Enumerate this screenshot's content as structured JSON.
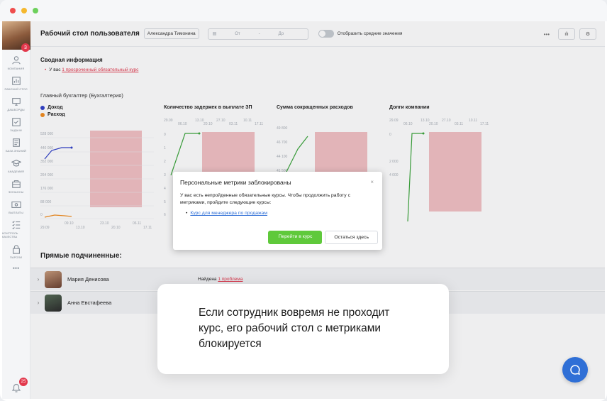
{
  "window": {
    "dots": [
      "#ef4d4d",
      "#f5b82e",
      "#6dd05c"
    ]
  },
  "sidebar": {
    "avatar_badge": "3",
    "items": [
      {
        "label": "Компания",
        "icon": "building-icon"
      },
      {
        "label": "Рабочий стол",
        "icon": "dashboard-icon"
      },
      {
        "label": "Дашборды",
        "icon": "monitor-icon"
      },
      {
        "label": "Задачи",
        "icon": "check-square-icon"
      },
      {
        "label": "База знаний",
        "icon": "document-icon"
      },
      {
        "label": "Академия",
        "icon": "graduation-cap-icon"
      },
      {
        "label": "Финансы",
        "icon": "finance-icon"
      },
      {
        "label": "Выплаты",
        "icon": "money-icon"
      },
      {
        "label": "Контроль качества",
        "icon": "checklist-icon"
      },
      {
        "label": "Пароли",
        "icon": "lock-icon"
      }
    ],
    "more": "•••",
    "bell_badge": "25"
  },
  "header": {
    "title": "Рабочий стол пользователя",
    "user": "Александра Тимонина",
    "date_from": "От",
    "date_sep": "-",
    "date_to": "До",
    "toggle_label": "Отобразить средние значения",
    "more": "•••",
    "chart_btn": "ılı",
    "settings_btn": "⚙"
  },
  "summary": {
    "title": "Сводная информация",
    "prefix": "У вас ",
    "link": "1 просроченный обязательный курс"
  },
  "role": "Главный бухгалтер (Бухгалтерия)",
  "charts": {
    "legend": [
      {
        "label": "Доход",
        "color": "#2f3fc9"
      },
      {
        "label": "Расход",
        "color": "#f28c1e"
      }
    ],
    "income_expense": {
      "y_ticks": [
        "528 000",
        "440 000",
        "352 000",
        "264 000",
        "176 000",
        "88 000",
        "0"
      ],
      "x_ticks_top": [
        "09.10",
        "23.10",
        "06.11"
      ],
      "x_ticks_bottom": [
        "29.09",
        "13.10",
        "20.10",
        "17.11"
      ]
    },
    "delays": {
      "title": "Количество задержек в выплате ЗП",
      "y_ticks": [
        "0",
        "1",
        "2",
        "3",
        "4",
        "5",
        "6"
      ],
      "dates_top": [
        "29.09",
        "13.10",
        "27.10",
        "10.11"
      ],
      "dates_bottom": [
        "06.10",
        "20.10",
        "03.11",
        "17.11"
      ]
    },
    "savings": {
      "title": "Сумма сокращенных расходов",
      "y_ticks": [
        "49 800",
        "46 700",
        "44 100",
        "41 500"
      ]
    },
    "debts": {
      "title": "Долги компании",
      "y_ticks": [
        "0",
        "2 000",
        "4 000"
      ],
      "dates_top": [
        "29.09",
        "13.10",
        "27.10",
        "10.11"
      ],
      "dates_bottom": [
        "06.10",
        "20.10",
        "03.11",
        "17.11"
      ]
    }
  },
  "subordinates": {
    "title": "Прямые подчиненные:",
    "rows": [
      {
        "name": "Мария Денисова",
        "status_prefix": "Найдена ",
        "status_link": "1 проблема"
      },
      {
        "name": "Анна Евстафеева",
        "status_prefix": "",
        "status_link": ""
      }
    ]
  },
  "modal": {
    "title": "Персональные метрики заблокированы",
    "close": "×",
    "text": "У вас есть непройденные обязательные курсы. Чтобы продолжить работу с метриками, пройдите следующие курсы:",
    "course": "Курс для менеджера по продажам",
    "primary": "Перейти в курс",
    "secondary": "Остаться здесь"
  },
  "caption": {
    "lines": [
      "Если сотрудник вовремя не проходит",
      "курс, его рабочий стол с метриками",
      "блокируется"
    ]
  }
}
